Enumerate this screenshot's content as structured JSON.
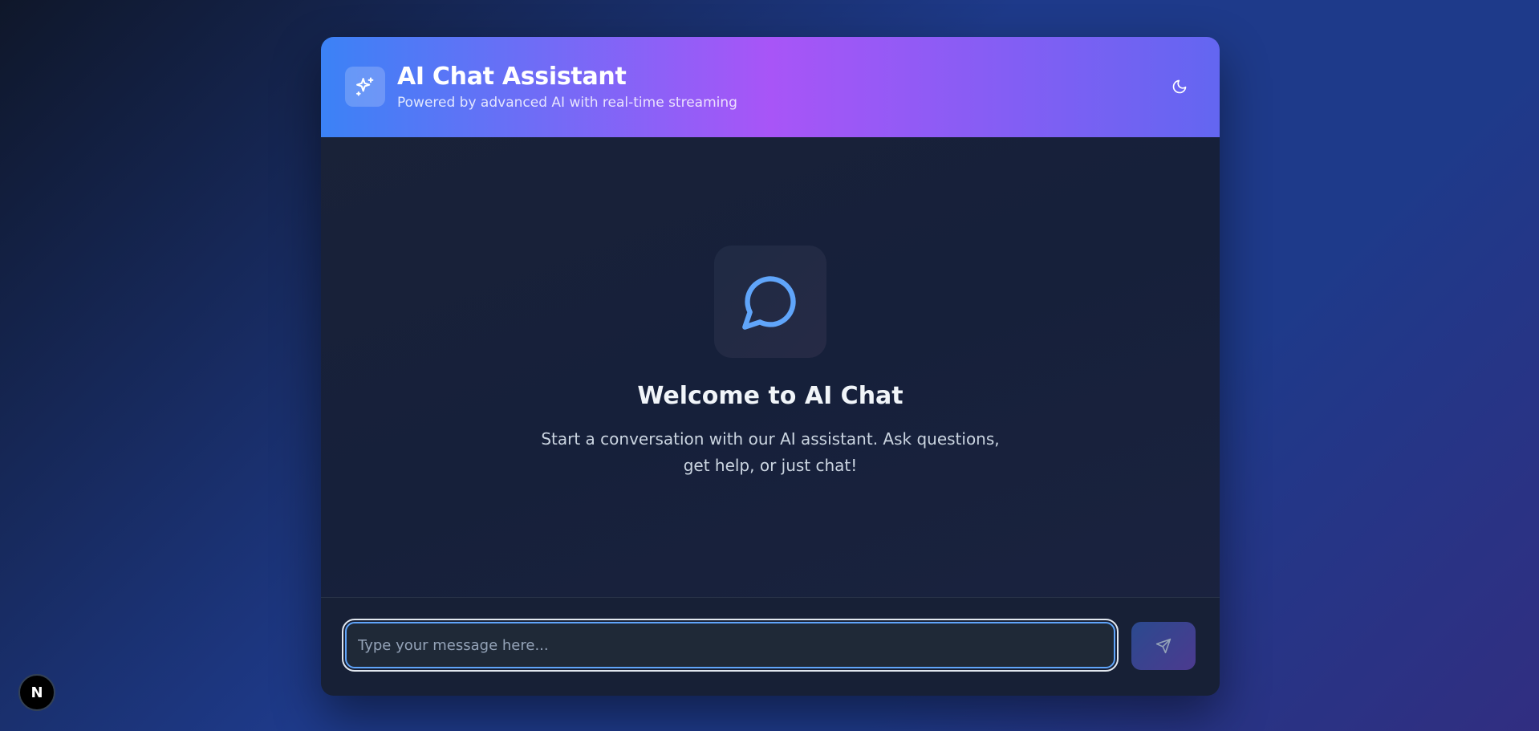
{
  "header": {
    "title": "AI Chat Assistant",
    "subtitle": "Powered by advanced AI with real-time streaming",
    "logo_icon": "sparkles-icon",
    "theme_toggle_icon": "moon-icon"
  },
  "welcome": {
    "icon": "message-circle-icon",
    "title": "Welcome to AI Chat",
    "text": "Start a conversation with our AI assistant. Ask questions, get help, or just chat!"
  },
  "composer": {
    "placeholder": "Type your message here...",
    "value": "",
    "send_icon": "send-icon"
  },
  "dev_badge": {
    "label": "N"
  },
  "colors": {
    "header_gradient_start": "#3b82f6",
    "header_gradient_mid": "#a855f7",
    "header_gradient_end": "#6366f1",
    "accent_blue": "#60a5fa",
    "card_background": "#16203a"
  }
}
